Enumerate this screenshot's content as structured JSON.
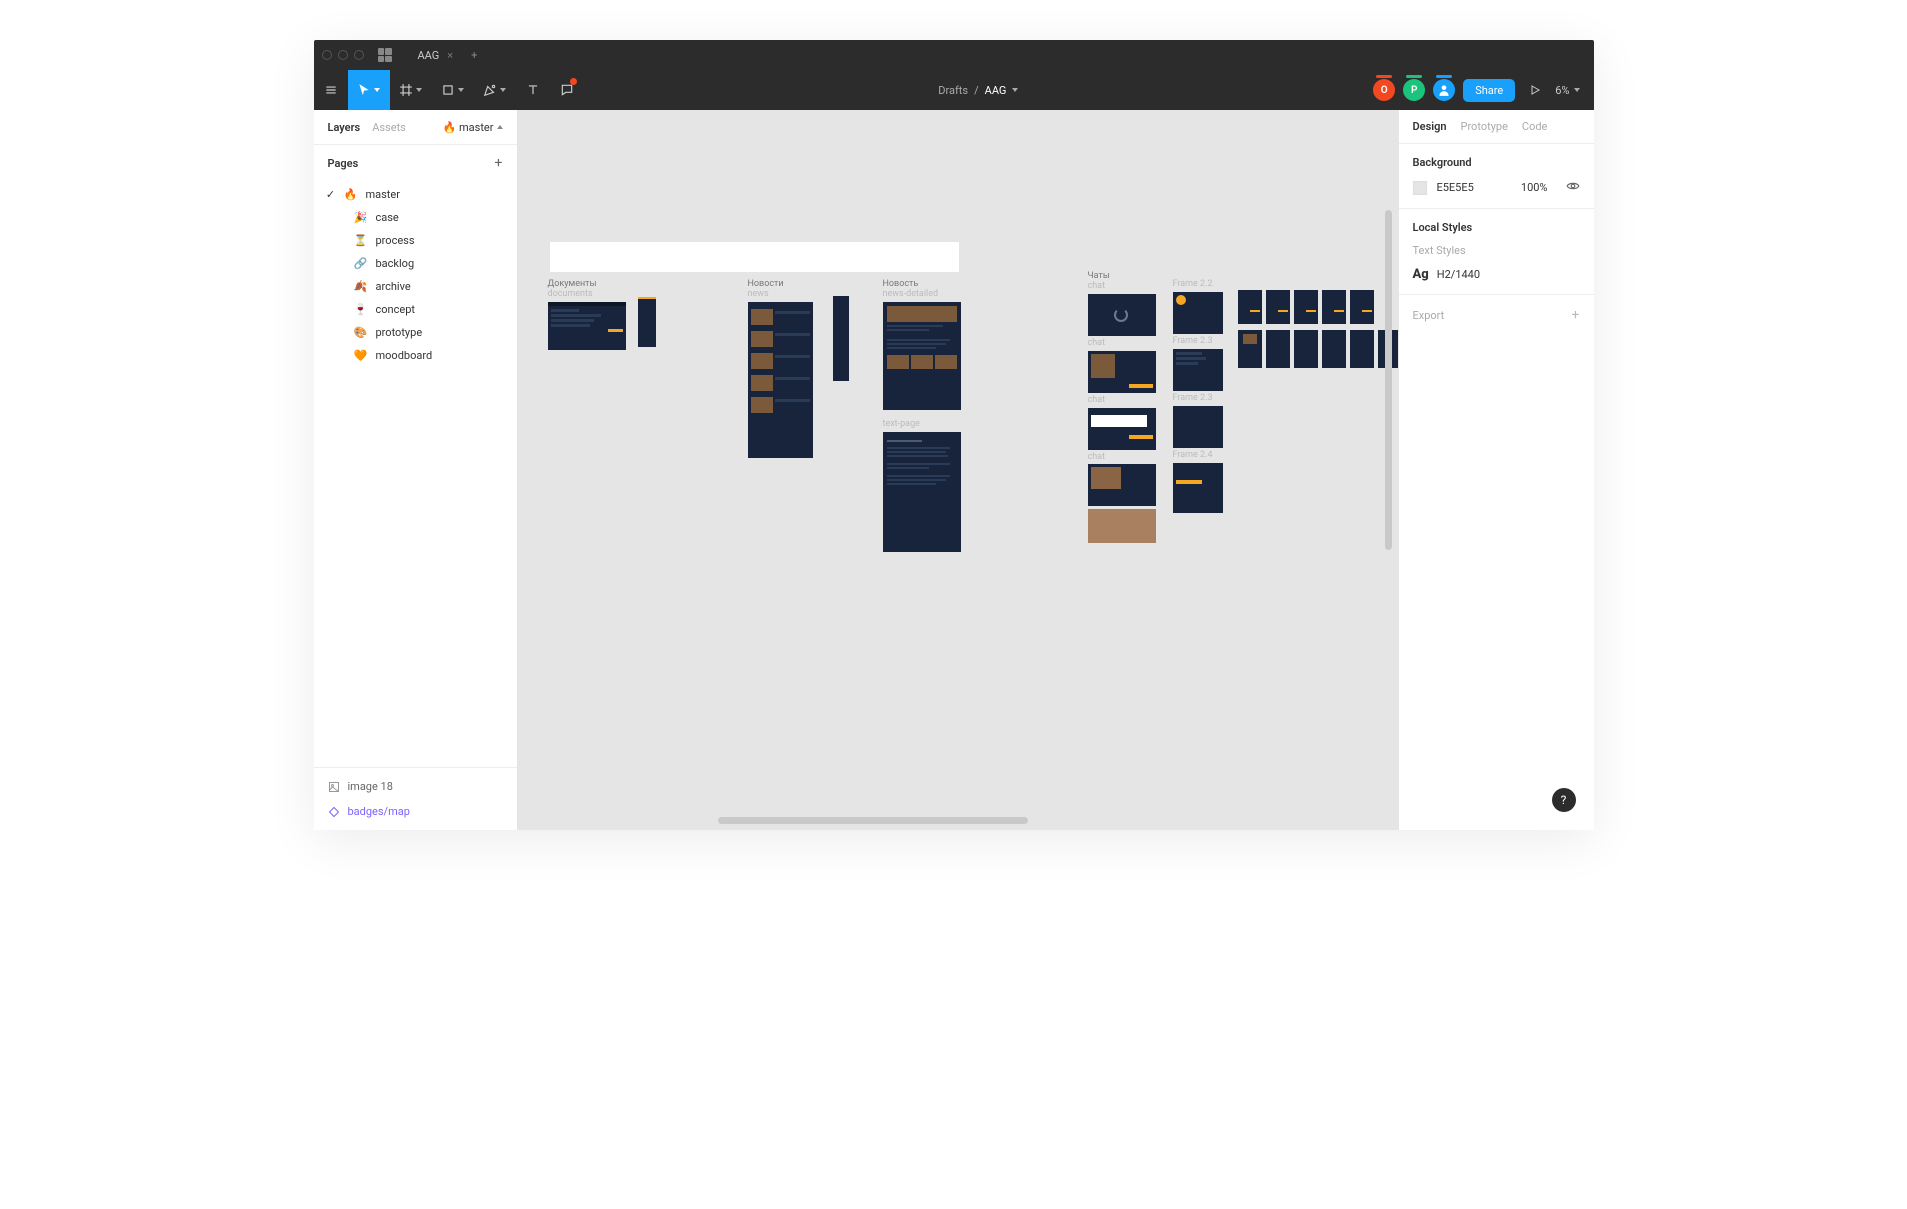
{
  "tabbar": {
    "file_tab": "AAG"
  },
  "toolbar": {
    "location": "Drafts",
    "separator": "/",
    "docname": "AAG",
    "share_label": "Share",
    "zoom": "6%",
    "avatars": {
      "o": "O",
      "p": "P"
    }
  },
  "leftpanel": {
    "tabs": {
      "layers": "Layers",
      "assets": "Assets"
    },
    "page_badge": "🔥 master",
    "pages_header": "Pages",
    "pages": [
      {
        "emoji": "🔥",
        "name": "master",
        "selected": true
      },
      {
        "emoji": "🎉",
        "name": "case"
      },
      {
        "emoji": "⏳",
        "name": "process"
      },
      {
        "emoji": "🔗",
        "name": "backlog"
      },
      {
        "emoji": "🍂",
        "name": "archive"
      },
      {
        "emoji": "🍷",
        "name": "concept"
      },
      {
        "emoji": "🎨",
        "name": "prototype"
      },
      {
        "emoji": "🧡",
        "name": "moodboard"
      }
    ],
    "bottom": {
      "image": "image 18",
      "component": "badges/map"
    }
  },
  "canvas": {
    "frames": {
      "documents": {
        "ru": "Документы",
        "en": "documents"
      },
      "news": {
        "ru": "Новости",
        "en": "news"
      },
      "news_detailed": {
        "ru": "Новость",
        "en": "news-detailed"
      },
      "text_page": "text-page",
      "chats": {
        "ru": "Чаты",
        "en": "chat"
      },
      "chat2": "chat",
      "chat3": "chat",
      "chat4": "chat",
      "f22": "Frame 2.2",
      "f23": "Frame 2.3",
      "f24": "Frame 2.3",
      "f25": "Frame 2.4"
    }
  },
  "rightpanel": {
    "tabs": {
      "design": "Design",
      "prototype": "Prototype",
      "code": "Code"
    },
    "background": {
      "title": "Background",
      "hex": "E5E5E5",
      "opacity": "100%"
    },
    "local_styles": {
      "title": "Local Styles",
      "text_styles": "Text Styles",
      "style_name": "H2/1440"
    },
    "export": "Export"
  },
  "help": "?"
}
